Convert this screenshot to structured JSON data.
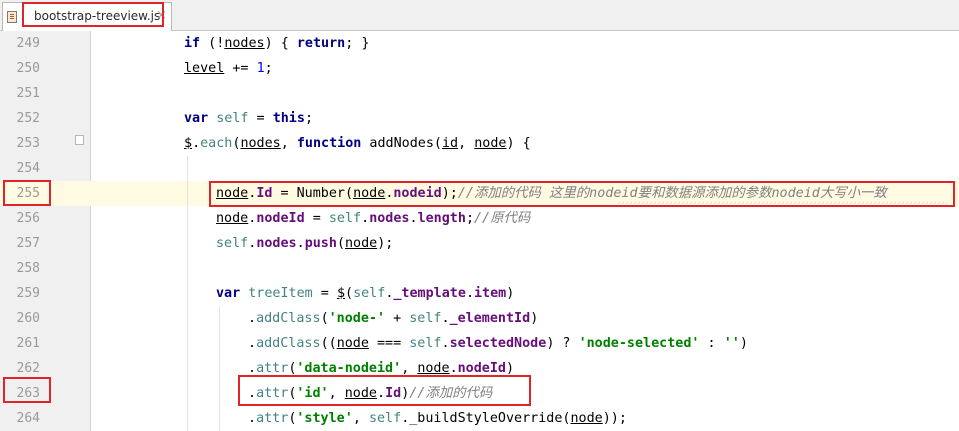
{
  "tab": {
    "label": "bootstrap-treeview.js",
    "close": "×",
    "icon": "js-file-icon"
  },
  "colors": {
    "highlight_box": "#e1232a",
    "keyword": "#000080",
    "property": "#660e7a",
    "string": "#008000",
    "comment": "#808080"
  },
  "lines": [
    {
      "num": "249",
      "indent": 0
    },
    {
      "num": "250",
      "indent": 0
    },
    {
      "num": "251",
      "indent": 0
    },
    {
      "num": "252",
      "indent": 0
    },
    {
      "num": "253",
      "indent": 0
    },
    {
      "num": "254",
      "indent": 0
    },
    {
      "num": "255",
      "indent": 1
    },
    {
      "num": "256",
      "indent": 1
    },
    {
      "num": "257",
      "indent": 1
    },
    {
      "num": "258",
      "indent": 0
    },
    {
      "num": "259",
      "indent": 1
    },
    {
      "num": "260",
      "indent": 2
    },
    {
      "num": "261",
      "indent": 2
    },
    {
      "num": "262",
      "indent": 2
    },
    {
      "num": "263",
      "indent": 2
    },
    {
      "num": "264",
      "indent": 2
    }
  ],
  "code": {
    "l249": [
      {
        "t": "if",
        "c": "kw"
      },
      {
        "t": " (!"
      },
      {
        "t": "nodes",
        "u": true
      },
      {
        "t": ") { "
      },
      {
        "t": "return",
        "c": "kw"
      },
      {
        "t": "; }"
      }
    ],
    "l250": [
      {
        "t": "level",
        "u": true
      },
      {
        "t": " += "
      },
      {
        "t": "1",
        "c": "num"
      },
      {
        "t": ";"
      }
    ],
    "l251": [],
    "l252": [
      {
        "t": "var",
        "c": "kw"
      },
      {
        "t": " "
      },
      {
        "t": "self",
        "c": "var"
      },
      {
        "t": " = "
      },
      {
        "t": "this",
        "c": "kw"
      },
      {
        "t": ";"
      }
    ],
    "l253": [
      {
        "t": "$",
        "u": true
      },
      {
        "t": "."
      },
      {
        "t": "each",
        "c": "self"
      },
      {
        "t": "("
      },
      {
        "t": "nodes",
        "u": true
      },
      {
        "t": ", "
      },
      {
        "t": "function",
        "c": "kw"
      },
      {
        "t": " addNodes("
      },
      {
        "t": "id",
        "u": true
      },
      {
        "t": ", "
      },
      {
        "t": "node",
        "u": true
      },
      {
        "t": ") {"
      }
    ],
    "l254": [],
    "l255": [
      {
        "t": "node",
        "u": true
      },
      {
        "t": "."
      },
      {
        "t": "Id",
        "c": "prop"
      },
      {
        "t": " = Number("
      },
      {
        "t": "node",
        "u": true
      },
      {
        "t": "."
      },
      {
        "t": "nodeid",
        "c": "prop"
      },
      {
        "t": ");"
      },
      {
        "t": "//添加的代码 这里的nodeid要和数据源添加的参数nodeid大写小一致",
        "c": "cmt"
      }
    ],
    "l256": [
      {
        "t": "node",
        "u": true
      },
      {
        "t": "."
      },
      {
        "t": "nodeId",
        "c": "prop"
      },
      {
        "t": " = "
      },
      {
        "t": "self",
        "c": "self"
      },
      {
        "t": "."
      },
      {
        "t": "nodes",
        "c": "prop"
      },
      {
        "t": "."
      },
      {
        "t": "length",
        "c": "prop"
      },
      {
        "t": ";"
      },
      {
        "t": "//原代码",
        "c": "cmt"
      }
    ],
    "l257": [
      {
        "t": "self",
        "c": "self"
      },
      {
        "t": "."
      },
      {
        "t": "nodes",
        "c": "prop"
      },
      {
        "t": "."
      },
      {
        "t": "push",
        "c": "prop"
      },
      {
        "t": "("
      },
      {
        "t": "node",
        "u": true
      },
      {
        "t": ");"
      }
    ],
    "l258": [],
    "l259": [
      {
        "t": "var",
        "c": "kw"
      },
      {
        "t": " "
      },
      {
        "t": "treeItem",
        "c": "var"
      },
      {
        "t": " = "
      },
      {
        "t": "$",
        "u": true
      },
      {
        "t": "("
      },
      {
        "t": "self",
        "c": "self"
      },
      {
        "t": "."
      },
      {
        "t": "_template",
        "c": "prop"
      },
      {
        "t": "."
      },
      {
        "t": "item",
        "c": "prop"
      },
      {
        "t": ")"
      }
    ],
    "l260": [
      {
        "t": "."
      },
      {
        "t": "addClass",
        "c": "self"
      },
      {
        "t": "("
      },
      {
        "t": "'node-'",
        "c": "str"
      },
      {
        "t": " + "
      },
      {
        "t": "self",
        "c": "self"
      },
      {
        "t": "."
      },
      {
        "t": "_elementId",
        "c": "prop"
      },
      {
        "t": ")"
      }
    ],
    "l261": [
      {
        "t": "."
      },
      {
        "t": "addClass",
        "c": "self"
      },
      {
        "t": "(("
      },
      {
        "t": "node",
        "u": true
      },
      {
        "t": " === "
      },
      {
        "t": "self",
        "c": "self"
      },
      {
        "t": "."
      },
      {
        "t": "selectedNode",
        "c": "prop"
      },
      {
        "t": ") ? "
      },
      {
        "t": "'node-selected'",
        "c": "str"
      },
      {
        "t": " : "
      },
      {
        "t": "''",
        "c": "str"
      },
      {
        "t": ")"
      }
    ],
    "l262": [
      {
        "t": "."
      },
      {
        "t": "attr",
        "c": "self"
      },
      {
        "t": "("
      },
      {
        "t": "'data-nodeid'",
        "c": "str"
      },
      {
        "t": ", "
      },
      {
        "t": "node",
        "u": true
      },
      {
        "t": "."
      },
      {
        "t": "nodeId",
        "c": "prop"
      },
      {
        "t": ")"
      }
    ],
    "l263": [
      {
        "t": "."
      },
      {
        "t": "attr",
        "c": "self"
      },
      {
        "t": "("
      },
      {
        "t": "'id'",
        "c": "str"
      },
      {
        "t": ", "
      },
      {
        "t": "node",
        "u": true
      },
      {
        "t": "."
      },
      {
        "t": "Id",
        "c": "prop"
      },
      {
        "t": ")"
      },
      {
        "t": "//添加的代码",
        "c": "cmt"
      }
    ],
    "l264": [
      {
        "t": "."
      },
      {
        "t": "attr",
        "c": "self"
      },
      {
        "t": "("
      },
      {
        "t": "'style'",
        "c": "str"
      },
      {
        "t": ", "
      },
      {
        "t": "self",
        "c": "self"
      },
      {
        "t": "."
      },
      {
        "t": "_buildStyleOverride("
      },
      {
        "t": "node",
        "u": true
      },
      {
        "t": "));"
      }
    ]
  }
}
